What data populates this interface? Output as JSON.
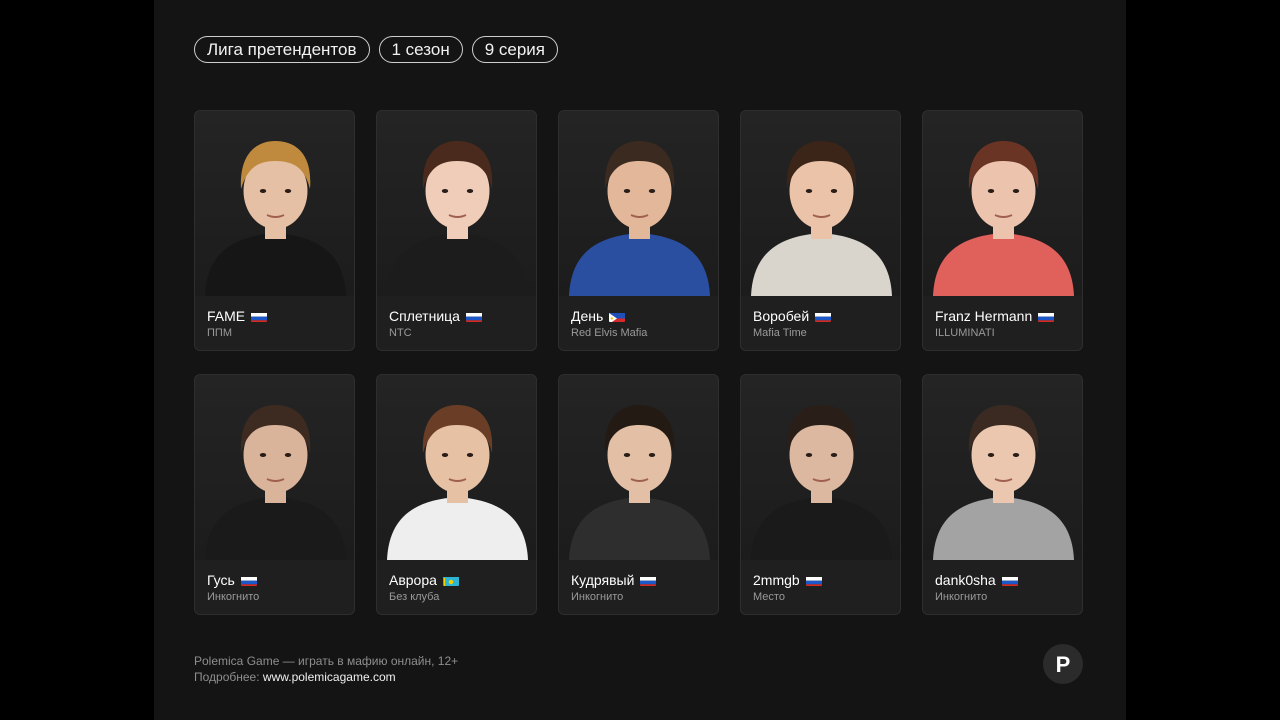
{
  "tags": [
    "Лига претендентов",
    "1 сезон",
    "9 серия"
  ],
  "players": [
    {
      "name": "FAME",
      "club": "ППМ",
      "flag": "ru",
      "hair": "#c08a3e",
      "top": "#161616",
      "skin": "#e6c0a4"
    },
    {
      "name": "Сплетница",
      "club": "NTC",
      "flag": "ru",
      "hair": "#4a2a1c",
      "top": "#1c1c1c",
      "skin": "#efcdb8"
    },
    {
      "name": "День",
      "club": "Red Elvis Mafia",
      "flag": "ph",
      "hair": "#3a2a20",
      "top": "#2a4fa0",
      "skin": "#e3b79a"
    },
    {
      "name": "Воробей",
      "club": "Mafia Time",
      "flag": "ru",
      "hair": "#3b2418",
      "top": "#d9d4cc",
      "skin": "#eac3a8"
    },
    {
      "name": "Franz Hermann",
      "club": "ILLUMINATI",
      "flag": "ru",
      "hair": "#6a3424",
      "top": "#e0605c",
      "skin": "#ecc3ad"
    },
    {
      "name": "Гусь",
      "club": "Инкогнито",
      "flag": "ru",
      "hair": "#3d2a20",
      "top": "#1a1a1a",
      "skin": "#d9b39a"
    },
    {
      "name": "Аврора",
      "club": "Без клуба",
      "flag": "kz",
      "hair": "#6a3e26",
      "top": "#eeeeee",
      "skin": "#e7c1a4"
    },
    {
      "name": "Кудрявый",
      "club": "Инкогнито",
      "flag": "ru",
      "hair": "#241a14",
      "top": "#2e2e2e",
      "skin": "#e2bfa5"
    },
    {
      "name": "2mmgb",
      "club": "Место",
      "flag": "ru",
      "hair": "#2a1e18",
      "top": "#1a1a1a",
      "skin": "#dcb8a0"
    },
    {
      "name": "dank0sha",
      "club": "Инкогнито",
      "flag": "ru",
      "hair": "#3a2a22",
      "top": "#a3a3a3",
      "skin": "#eac7ae"
    }
  ],
  "footer": {
    "line1": "Polemica Game — играть в мафию онлайн, 12+",
    "line2_prefix": "Подробнее: ",
    "line2_link": "www.polemicagame.com"
  },
  "logo": {
    "letter": "P"
  }
}
